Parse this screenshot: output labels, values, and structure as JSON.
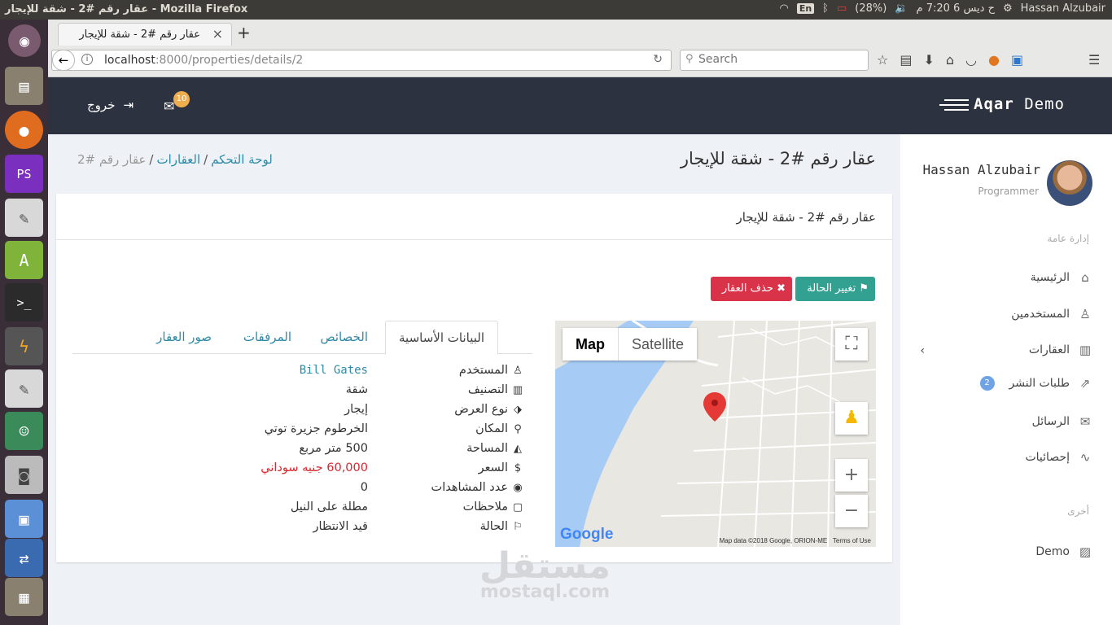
{
  "os": {
    "window_title": "عقار رقم #2 - شقة للإيجار - Mozilla Firefox",
    "lang": "En",
    "battery": "(28%)",
    "clock": "ح ديس  6  7:20 م",
    "user": "Hassan Alzubair"
  },
  "browser": {
    "tab_title": "عقار رقم #2 - شقة للإيجار",
    "url_host": "localhost",
    "url_path": ":8000/properties/details/2",
    "search_placeholder": "Search"
  },
  "header": {
    "logo_bold": "Aqar",
    "logo_rest": " Demo",
    "logout": "خروج",
    "mail_count": "10"
  },
  "sidebar": {
    "user_name": "Hassan Alzubair",
    "user_role": "Programmer",
    "section_general": "إدارة عامة",
    "items": [
      {
        "label": "الرئيسية",
        "icon": "home-icon"
      },
      {
        "label": "المستخدمين",
        "icon": "user-icon"
      },
      {
        "label": "العقارات",
        "icon": "building-icon"
      },
      {
        "label": "طلبات النشر",
        "icon": "share-icon",
        "badge": "2"
      },
      {
        "label": "الرسائل",
        "icon": "envelope-icon"
      },
      {
        "label": "إحصائيات",
        "icon": "chart-icon"
      }
    ],
    "section_other": "أخرى",
    "other_items": [
      {
        "label": "Demo",
        "icon": "image-icon"
      }
    ]
  },
  "main": {
    "page_title": "عقار رقم #2 - شقة للإيجار",
    "breadcrumb": {
      "home": "لوحة التحكم",
      "section": "العقارات",
      "current": "عقار رقم #2"
    },
    "card_title": "عقار رقم #2 - شقة للإيجار",
    "btn_change_status": "تغيير الحالة",
    "btn_delete": "حذف العقار",
    "tabs": [
      "البيانات الأساسية",
      "الخصائص",
      "المرفقات",
      "صور العقار"
    ],
    "details": [
      {
        "label": "المستخدم",
        "value": "Bill Gates",
        "icon": "user-icon"
      },
      {
        "label": "التصنيف",
        "value": "شقة",
        "icon": "building-icon"
      },
      {
        "label": "نوع العرض",
        "value": "إيجار",
        "icon": "tags-icon"
      },
      {
        "label": "المكان",
        "value": "الخرطوم جزيرة توتي",
        "icon": "map-marker-icon"
      },
      {
        "label": "المساحة",
        "value": "500 متر مربع",
        "icon": "area-chart-icon"
      },
      {
        "label": "السعر",
        "value": "60,000 جنيه سوداني",
        "icon": "dollar-icon"
      },
      {
        "label": "عدد المشاهدات",
        "value": "0",
        "icon": "eye-icon"
      },
      {
        "label": "ملاحظات",
        "value": "مطلة على النيل",
        "icon": "sticky-note-icon"
      },
      {
        "label": "الحالة",
        "value": "قيد الانتظار",
        "icon": "flag-icon"
      }
    ],
    "map": {
      "type_map": "Map",
      "type_satellite": "Satellite",
      "google": "Google",
      "footer_data": "Map data ©2018 Google, ORION-ME",
      "footer_terms": "Terms of Use"
    }
  },
  "watermark": {
    "ar": "مستقل",
    "en": "mostaql.com"
  },
  "colors": {
    "header": "#2c323f",
    "teal": "#33a191",
    "red": "#d9334a",
    "link": "#2e8ba8",
    "price": "#d9272e"
  }
}
